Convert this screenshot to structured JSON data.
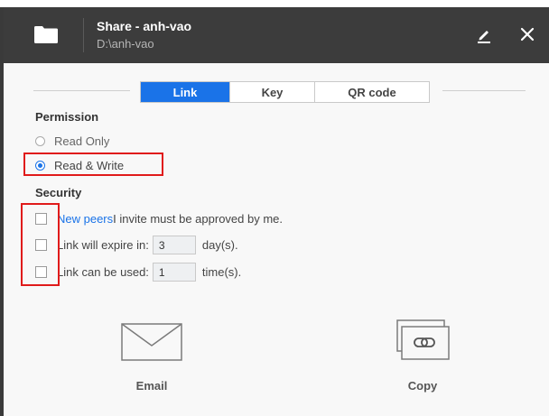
{
  "header": {
    "title": "Share - anh-vao",
    "path": "D:\\anh-vao"
  },
  "tabs": [
    {
      "label": "Link",
      "active": true
    },
    {
      "label": "Key",
      "active": false
    },
    {
      "label": "QR code",
      "active": false
    }
  ],
  "permission": {
    "heading": "Permission",
    "options": [
      {
        "label": "Read Only",
        "selected": false
      },
      {
        "label": "Read & Write",
        "selected": true
      }
    ]
  },
  "security": {
    "heading": "Security",
    "approve": {
      "link_text": "New peers",
      "text": " I invite must be approved by me.",
      "checked": false
    },
    "expire": {
      "label": "Link will expire in:",
      "value": "3",
      "unit": "day(s).",
      "checked": false
    },
    "uses": {
      "label": "Link can be used:",
      "value": "1",
      "unit": "time(s).",
      "checked": false
    }
  },
  "actions": {
    "email": "Email",
    "copy": "Copy"
  },
  "colors": {
    "header_bg": "#3c3c3c",
    "accent": "#1a73e8",
    "highlight": "#e01b1b"
  }
}
